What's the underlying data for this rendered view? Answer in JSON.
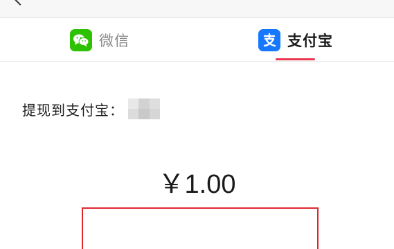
{
  "header": {
    "back_icon": "back-arrow-icon"
  },
  "tabs": [
    {
      "label": "微信",
      "icon": "wechat-icon",
      "color": "#2dc100",
      "active": false
    },
    {
      "label": "支付宝",
      "icon": "alipay-icon",
      "color": "#1677ff",
      "active": true
    }
  ],
  "tab_indicator_color": "#e8384f",
  "withdraw": {
    "label": "提现到支付宝："
  },
  "amount": "￥1.00",
  "highlight_color": "#e0252c"
}
